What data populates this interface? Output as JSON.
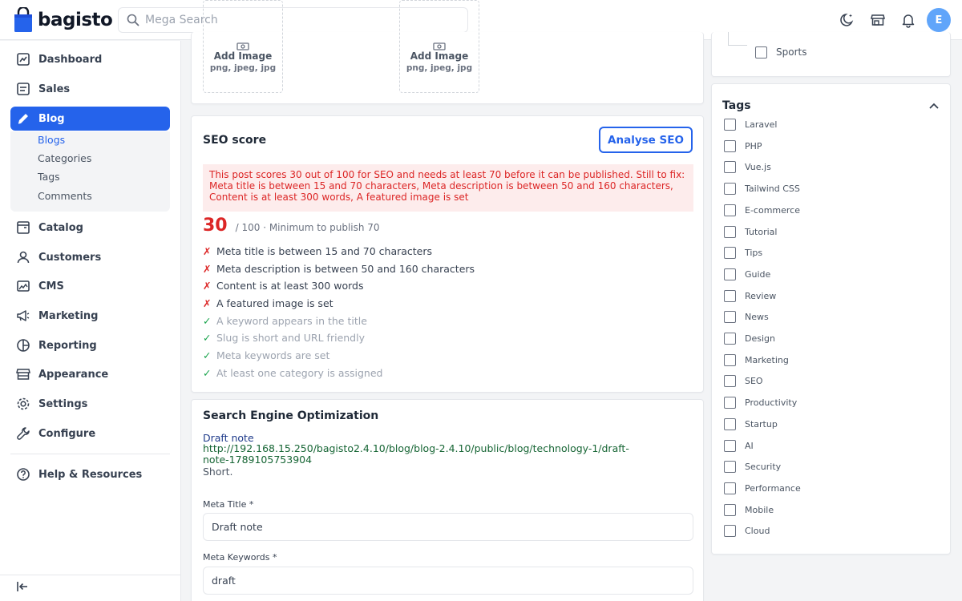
{
  "header": {
    "logo_text": "bagisto",
    "search_placeholder": "Mega Search",
    "avatar_letter": "E"
  },
  "sidebar": {
    "items": [
      {
        "label": "Dashboard",
        "icon": "dashboard-icon"
      },
      {
        "label": "Sales",
        "icon": "sales-icon"
      },
      {
        "label": "Blog",
        "icon": "pencil-icon",
        "active": true
      },
      {
        "label": "Catalog",
        "icon": "catalog-icon"
      },
      {
        "label": "Customers",
        "icon": "customers-icon"
      },
      {
        "label": "CMS",
        "icon": "cms-icon"
      },
      {
        "label": "Marketing",
        "icon": "megaphone-icon"
      },
      {
        "label": "Reporting",
        "icon": "pie-chart-icon"
      },
      {
        "label": "Appearance",
        "icon": "store-icon"
      },
      {
        "label": "Settings",
        "icon": "gear-icon"
      },
      {
        "label": "Configure",
        "icon": "wrench-icon"
      }
    ],
    "blog_subitems": [
      "Blogs",
      "Categories",
      "Tags",
      "Comments"
    ],
    "help_label": "Help & Resources"
  },
  "images": {
    "add_label": "Add Image",
    "formats": "png, jpeg, jpg"
  },
  "seo_score": {
    "title": "SEO score",
    "analyse_button": "Analyse SEO",
    "alert": "This post scores 30 out of 100 for SEO and needs at least 70 before it can be published. Still to fix: Meta title is between 15 and 70 characters, Meta description is between 50 and 160 characters, Content is at least 300 words, A featured image is set",
    "score": "30",
    "score_suffix": "/ 100 · Minimum to publish 70",
    "checks": [
      {
        "mark": "✗",
        "text": "Meta title is between 15 and 70 characters",
        "pass": false
      },
      {
        "mark": "✗",
        "text": "Meta description is between 50 and 160 characters",
        "pass": false
      },
      {
        "mark": "✗",
        "text": "Content is at least 300 words",
        "pass": false
      },
      {
        "mark": "✗",
        "text": "A featured image is set",
        "pass": false
      },
      {
        "mark": "✓",
        "text": "A keyword appears in the title",
        "pass": true
      },
      {
        "mark": "✓",
        "text": "Slug is short and URL friendly",
        "pass": true
      },
      {
        "mark": "✓",
        "text": "Meta keywords are set",
        "pass": true
      },
      {
        "mark": "✓",
        "text": "At least one category is assigned",
        "pass": true
      }
    ]
  },
  "seo": {
    "title": "Search Engine Optimization",
    "preview_title": "Draft note",
    "preview_url": "http://192.168.15.250/bagisto2.4.10/blog/blog-2.4.10/public/blog/technology-1/draft-note-1789105753904",
    "preview_desc": "Short.",
    "meta_title_label": "Meta Title *",
    "meta_title_value": "Draft note",
    "meta_keywords_label": "Meta Keywords *",
    "meta_keywords_value": "draft"
  },
  "categories": {
    "last_item": "Sports"
  },
  "tags": {
    "title": "Tags",
    "items": [
      "Laravel",
      "PHP",
      "Vue.js",
      "Tailwind CSS",
      "E-commerce",
      "Tutorial",
      "Tips",
      "Guide",
      "Review",
      "News",
      "Design",
      "Marketing",
      "SEO",
      "Productivity",
      "Startup",
      "AI",
      "Security",
      "Performance",
      "Mobile",
      "Cloud"
    ]
  },
  "colors": {
    "accent": "#2563eb",
    "danger": "#dc2626",
    "success": "#16a34a"
  }
}
